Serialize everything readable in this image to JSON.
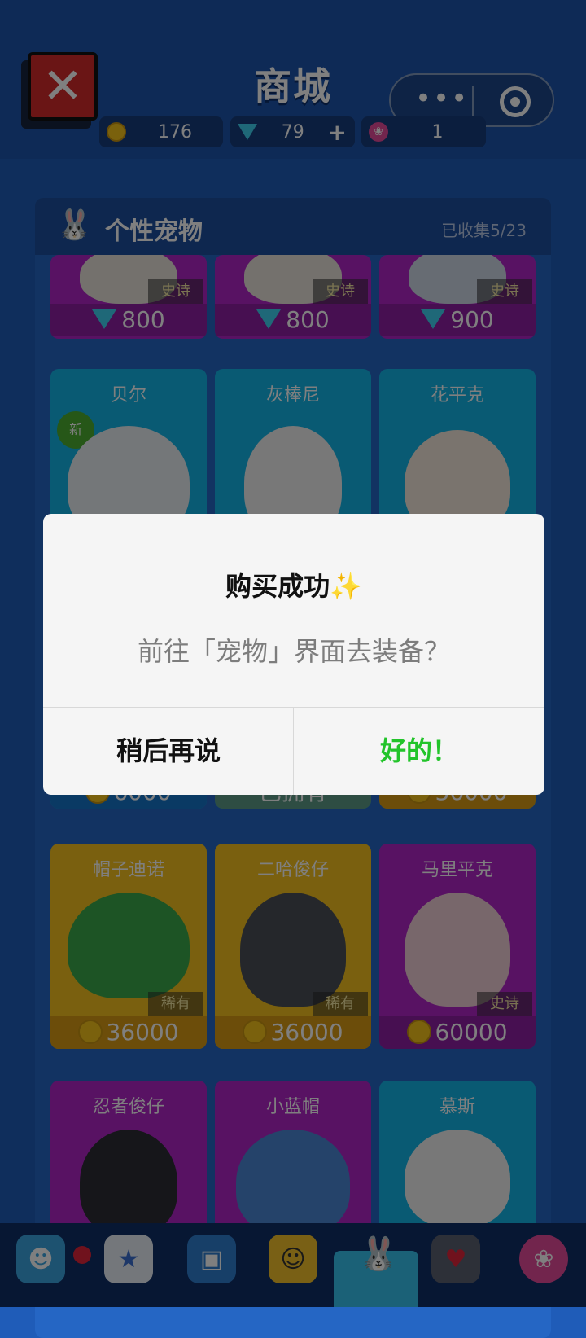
{
  "header": {
    "title": "商城",
    "close_icon": "close-icon",
    "capsule": {
      "more_icon": "more-dots-icon",
      "exit_icon": "target-icon"
    }
  },
  "currencies": [
    {
      "icon": "coin-icon",
      "value": "176"
    },
    {
      "icon": "gem-icon",
      "value": "79",
      "action": "+"
    },
    {
      "icon": "lotus-icon",
      "value": "1"
    }
  ],
  "panel": {
    "title": "个性宠物",
    "collected": "已收集5/23"
  },
  "cards": [
    {
      "name": "",
      "rarity": "史诗",
      "price": "800",
      "currency": "gem"
    },
    {
      "name": "",
      "rarity": "史诗",
      "price": "800",
      "currency": "gem"
    },
    {
      "name": "",
      "rarity": "史诗",
      "price": "900",
      "currency": "gem"
    },
    {
      "name": "贝尔",
      "badge": "新",
      "price": "6000",
      "currency": "coin"
    },
    {
      "name": "灰棒尼",
      "status": "已拥有"
    },
    {
      "name": "花平克",
      "price": "36000",
      "currency": "coin"
    },
    {
      "name": "帽子迪诺",
      "rarity": "稀有",
      "price": "36000",
      "currency": "coin"
    },
    {
      "name": "二哈俊仔",
      "rarity": "稀有",
      "price": "36000",
      "currency": "coin"
    },
    {
      "name": "马里平克",
      "rarity": "史诗",
      "price": "60000",
      "currency": "coin"
    },
    {
      "name": "忍者俊仔",
      "price": "",
      "currency": "coin"
    },
    {
      "name": "小蓝帽",
      "price": "",
      "currency": "coin"
    },
    {
      "name": "慕斯",
      "price": "",
      "currency": "coin"
    }
  ],
  "dialog": {
    "title": "购买成功✨",
    "message": "前往「宠物」界面去装备？",
    "cancel_label": "稍后再说",
    "ok_label": "好的！"
  },
  "tabbar": {
    "items": [
      "avatar-icon",
      "star-icon",
      "tv-icon",
      "face-icon",
      "rabbit-icon",
      "medal-icon",
      "lotus-icon"
    ]
  },
  "colors": {
    "accent_green": "#22c42a",
    "epic_purple": "#b124c7",
    "bg_blue": "#1f5cb8"
  }
}
